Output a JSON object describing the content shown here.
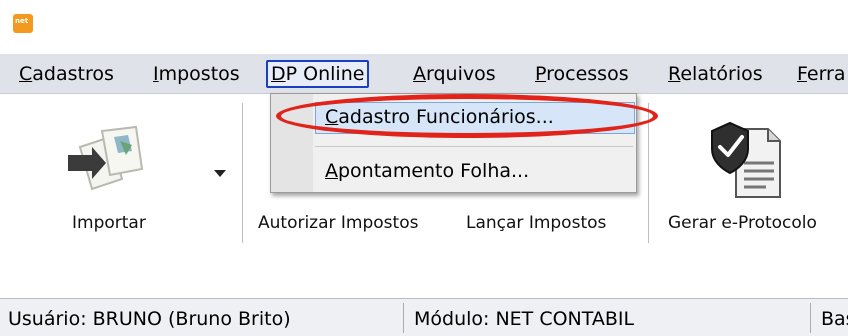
{
  "app": {
    "logo_text": "net"
  },
  "menubar": {
    "items": [
      {
        "label": "Cadastros",
        "hotkey": "C",
        "rest": "adastros"
      },
      {
        "label": "Impostos",
        "hotkey": "I",
        "rest": "mpostos"
      },
      {
        "label": "DP Online",
        "hotkey": "D",
        "rest": "P Online"
      },
      {
        "label": "Arquivos",
        "hotkey": "A",
        "rest": "rquivos"
      },
      {
        "label": "Processos",
        "hotkey": "P",
        "rest": "rocessos"
      },
      {
        "label": "Relatórios",
        "hotkey": "R",
        "rest": "elatórios"
      },
      {
        "label": "Ferra",
        "hotkey": "F",
        "rest": "erra"
      }
    ]
  },
  "dropdown": {
    "items": [
      {
        "label": "Cadastro Funcionários...",
        "hotkey": "C",
        "rest": "adastro Funcionários..."
      },
      {
        "label": "Apontamento Folha...",
        "hotkey": "A",
        "rest": "pontamento Folha..."
      }
    ]
  },
  "ribbon": {
    "buttons": [
      {
        "label": "Importar",
        "icon": "import-folders-icon"
      },
      {
        "label": "Autorizar Impostos"
      },
      {
        "label": "Lançar Impostos"
      },
      {
        "label": "Gerar e-Protocolo",
        "icon": "secure-document-icon"
      }
    ]
  },
  "statusbar": {
    "user": "Usuário: BRUNO (Bruno Brito)",
    "module": "Módulo: NET CONTABIL",
    "base": "Bas"
  },
  "colors": {
    "menubar_bg": "#dfe2e8",
    "active_menu_border": "#1a3fbf",
    "annotation": "#e2231a",
    "logo": "#f39a1e"
  }
}
